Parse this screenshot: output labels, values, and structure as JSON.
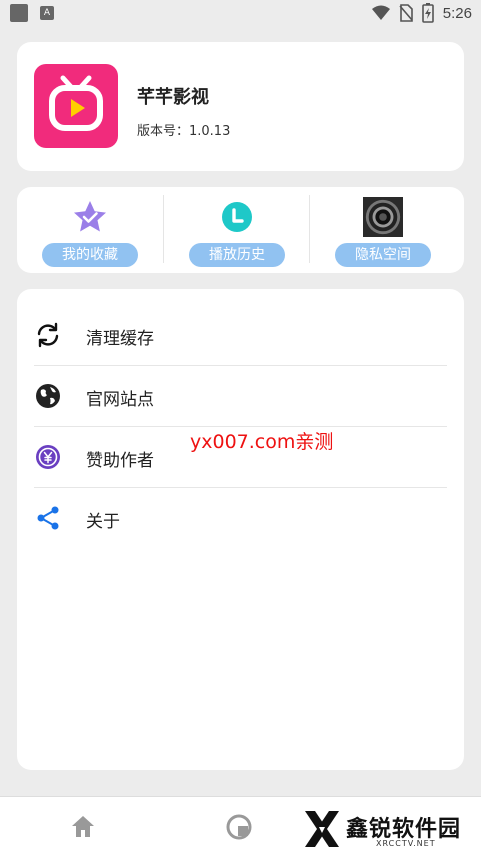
{
  "status_bar": {
    "time": "5:26",
    "notif_letter": "A"
  },
  "app": {
    "name": "芊芊影视",
    "version": "版本号：1.0.13",
    "brand_color": "#f12b7c"
  },
  "quick_actions": [
    {
      "label": "我的收藏",
      "icon": "star-check-icon"
    },
    {
      "label": "播放历史",
      "icon": "clock-icon"
    },
    {
      "label": "隐私空间",
      "icon": "camera-lens-icon"
    }
  ],
  "menu": [
    {
      "label": "清理缓存",
      "icon": "refresh-icon"
    },
    {
      "label": "官网站点",
      "icon": "globe-icon"
    },
    {
      "label": "赞助作者",
      "icon": "yen-coin-icon"
    },
    {
      "label": "关于",
      "icon": "share-icon"
    }
  ],
  "watermark": "yx007.com亲测",
  "bottom_nav": {
    "items": [
      {
        "icon": "home-icon"
      },
      {
        "icon": "profile-icon"
      }
    ],
    "brand_text": "鑫锐软件园",
    "brand_sub": "XRCCTV.NET"
  },
  "colors": {
    "quick_button": "#91c2f1",
    "background": "#ececec",
    "watermark": "#ee1111"
  }
}
